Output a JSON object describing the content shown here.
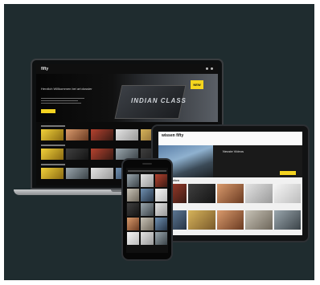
{
  "laptop": {
    "logo_text": "fifty",
    "hero_title": "Herzlich Willkommen bei art:dossier",
    "hero_device_text": "INDIAN CLASS",
    "badge_text": "NEW"
  },
  "tablet": {
    "logo_text": "wissen fifty",
    "hero_title": "Neuste Videos",
    "section_1": "Meist gesehen",
    "section_2": "Neu"
  },
  "colors": {
    "background": "#1f2c2f",
    "accent": "#f3d321"
  }
}
